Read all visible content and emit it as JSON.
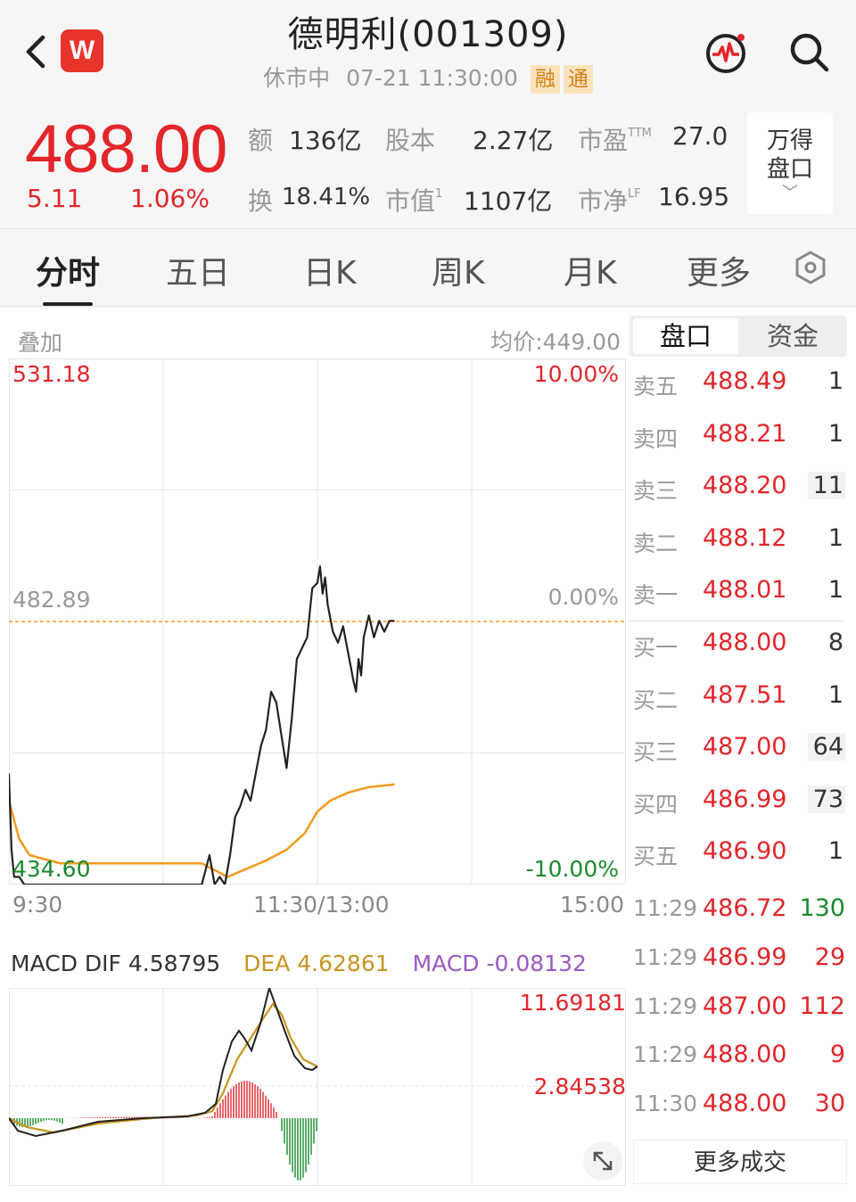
{
  "header": {
    "title": "德明利(001309)",
    "market_status": "休市中",
    "datetime": "07-21 11:30:00",
    "tag_margin": "融",
    "tag_connect": "通",
    "logo_letter": "W"
  },
  "quote": {
    "price": "488.00",
    "change": "5.11",
    "change_pct": "1.06%",
    "stats": [
      {
        "label": "额",
        "sup": "",
        "value": "136亿"
      },
      {
        "label": "股本",
        "sup": "",
        "value": "2.27亿"
      },
      {
        "label": "市盈",
        "sup": "TTM",
        "value": "27.0"
      },
      {
        "label": "换",
        "sup": "",
        "value": "18.41%"
      },
      {
        "label": "市值",
        "sup": "1",
        "value": "1107亿"
      },
      {
        "label": "市净",
        "sup": "LF",
        "value": "16.95"
      }
    ],
    "wind_button": {
      "line1": "万得",
      "line2": "盘口",
      "chevron": "﹀"
    }
  },
  "tabs": [
    "分时",
    "五日",
    "日K",
    "周K",
    "月K",
    "更多"
  ],
  "chart": {
    "overlay_label": "叠加",
    "avg_price_label": "均价:449.00",
    "y_max": "531.18",
    "y_mid": "482.89",
    "y_min": "434.60",
    "pct_max": "10.00%",
    "pct_mid": "0.00%",
    "pct_min": "-10.00%",
    "time_start": "9:30",
    "time_mid": "11:30/13:00",
    "time_end": "15:00"
  },
  "chart_data": {
    "type": "line",
    "x_range": [
      "9:30",
      "15:00"
    ],
    "ylim": [
      434.6,
      531.18
    ],
    "reference": 482.89,
    "series": [
      {
        "name": "price",
        "points": [
          [
            0,
            455
          ],
          [
            1,
            441
          ],
          [
            2,
            436
          ],
          [
            4,
            436
          ],
          [
            6,
            434.6
          ],
          [
            20,
            434.6
          ],
          [
            40,
            434.6
          ],
          [
            60,
            434.6
          ],
          [
            75,
            434.6
          ],
          [
            78,
            440
          ],
          [
            80,
            434.6
          ],
          [
            82,
            436
          ],
          [
            84,
            434.6
          ],
          [
            86,
            440
          ],
          [
            88,
            447
          ],
          [
            90,
            449
          ],
          [
            92,
            452
          ],
          [
            94,
            450
          ],
          [
            96,
            455
          ],
          [
            98,
            460
          ],
          [
            100,
            463
          ],
          [
            102,
            470
          ],
          [
            104,
            468
          ],
          [
            106,
            462
          ],
          [
            108,
            456
          ],
          [
            110,
            465
          ],
          [
            112,
            476
          ],
          [
            114,
            478
          ],
          [
            116,
            480
          ],
          [
            118,
            489
          ],
          [
            120,
            490
          ],
          [
            121,
            493
          ],
          [
            122,
            488
          ],
          [
            123,
            491
          ],
          [
            124,
            486
          ],
          [
            126,
            481
          ],
          [
            128,
            479
          ],
          [
            130,
            482
          ],
          [
            132,
            477
          ],
          [
            134,
            472
          ],
          [
            135,
            470
          ],
          [
            136,
            476
          ],
          [
            137,
            473
          ],
          [
            138,
            480
          ],
          [
            140,
            484
          ],
          [
            142,
            480
          ],
          [
            144,
            483
          ],
          [
            146,
            481
          ],
          [
            148,
            483
          ],
          [
            150,
            483
          ]
        ]
      },
      {
        "name": "avg",
        "points": [
          [
            0,
            450
          ],
          [
            4,
            443
          ],
          [
            8,
            440
          ],
          [
            20,
            438.5
          ],
          [
            60,
            438.5
          ],
          [
            75,
            438.5
          ],
          [
            85,
            436
          ],
          [
            90,
            437
          ],
          [
            100,
            439
          ],
          [
            108,
            441
          ],
          [
            115,
            444
          ],
          [
            120,
            448
          ],
          [
            125,
            450
          ],
          [
            132,
            451.5
          ],
          [
            140,
            452.5
          ],
          [
            150,
            453
          ]
        ]
      }
    ]
  },
  "order_book": {
    "tabs": [
      "盘口",
      "资金"
    ],
    "asks": [
      {
        "level": "卖五",
        "price": "488.49",
        "volume": "1"
      },
      {
        "level": "卖四",
        "price": "488.21",
        "volume": "1"
      },
      {
        "level": "卖三",
        "price": "488.20",
        "volume": "11"
      },
      {
        "level": "卖二",
        "price": "488.12",
        "volume": "1"
      },
      {
        "level": "卖一",
        "price": "488.01",
        "volume": "1"
      }
    ],
    "bids": [
      {
        "level": "买一",
        "price": "488.00",
        "volume": "8"
      },
      {
        "level": "买二",
        "price": "487.51",
        "volume": "1"
      },
      {
        "level": "买三",
        "price": "487.00",
        "volume": "64"
      },
      {
        "level": "买四",
        "price": "486.99",
        "volume": "73"
      },
      {
        "level": "买五",
        "price": "486.90",
        "volume": "1"
      }
    ]
  },
  "trades": [
    {
      "time": "11:29",
      "price": "486.72",
      "volume": "130",
      "color": "#1a8a2e"
    },
    {
      "time": "11:29",
      "price": "486.99",
      "volume": "29",
      "color": "#e2262b"
    },
    {
      "time": "11:29",
      "price": "487.00",
      "volume": "112",
      "color": "#e2262b"
    },
    {
      "time": "11:29",
      "price": "488.00",
      "volume": "9",
      "color": "#e2262b"
    },
    {
      "time": "11:30",
      "price": "488.00",
      "volume": "30",
      "color": "#e2262b"
    }
  ],
  "more_trades_label": "更多成交",
  "macd": {
    "dif_label": "MACD DIF 4.58795",
    "dea_label": "DEA 4.62861",
    "macd_label": "MACD -0.08132",
    "y_top": "11.69181",
    "y_mid": "2.84538"
  },
  "colors": {
    "up": "#e2262b",
    "down": "#1a8a2e",
    "avg_line": "#f39a1d",
    "dea_line": "#c8951f",
    "macd_label": "#9b59c6"
  }
}
